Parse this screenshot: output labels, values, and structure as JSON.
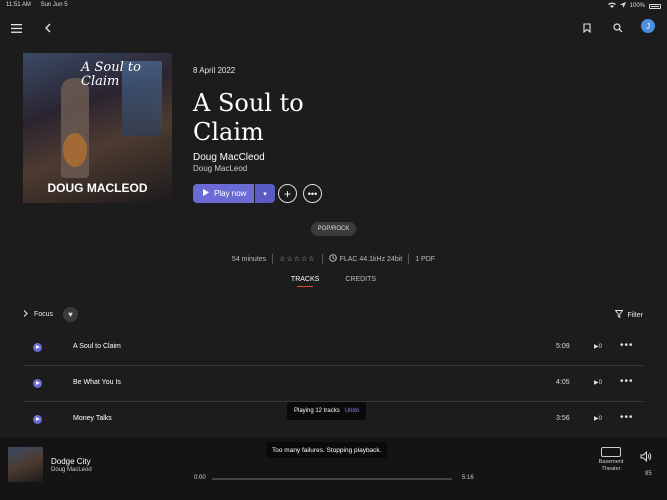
{
  "status": {
    "time": "11:51 AM",
    "date": "Sun Jun 5",
    "battery": "100%"
  },
  "album": {
    "release_date": "8 April 2022",
    "title": "A Soul to Claim",
    "artist_primary": "Doug MacCleod",
    "artist_secondary": "Doug MacLeod",
    "cover_title": "A Soul to Claim",
    "cover_artist": "DOUG MACLEOD",
    "genre": "POP/ROCK",
    "duration": "54 minutes",
    "rating": "☆☆☆☆☆",
    "quality": "FLAC 44.1kHz 24bit",
    "pdf": "1 PDF"
  },
  "actions": {
    "play_label": "Play now"
  },
  "tabs": [
    {
      "label": "TRACKS",
      "active": true
    },
    {
      "label": "CREDITS",
      "active": false
    }
  ],
  "toolbar": {
    "focus_label": "Focus",
    "filter_label": "Filter"
  },
  "tracks": [
    {
      "name": "A Soul to Claim",
      "duration": "5:09",
      "plays": "0"
    },
    {
      "name": "Be What You Is",
      "duration": "4:05",
      "plays": "0"
    },
    {
      "name": "Money Talks",
      "duration": "3:56",
      "plays": "0"
    }
  ],
  "toast": {
    "message": "Playing 12 tracks",
    "action": "Undo"
  },
  "player": {
    "title": "Dodge City",
    "artist": "Doug MacLeod",
    "time_start": "0:00",
    "time_end": "5:16",
    "progress": 0,
    "device": "Basement Theater",
    "volume": "85",
    "error": "Too many failures. Stopping playback."
  },
  "colors": {
    "accent": "#6b6bd6",
    "tab_underline": "#e04b3a",
    "background": "#1c1c1c"
  }
}
